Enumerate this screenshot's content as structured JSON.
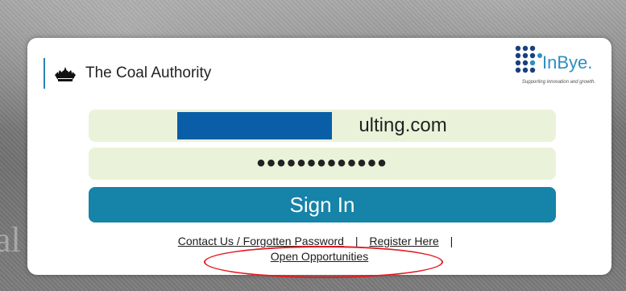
{
  "brand": {
    "name": "The Coal Authority"
  },
  "partner": {
    "name": "InBye.",
    "tagline": "Supporting innovation and growth."
  },
  "login": {
    "email_value": "ne                          ulting.com",
    "password_value": "•••••••••••••",
    "sign_in_label": "Sign In"
  },
  "links": {
    "contact_label": "Contact Us / Forgotten Password",
    "separator": "|",
    "register_label": "Register Here",
    "opportunities_label": "Open Opportunities"
  },
  "colors": {
    "field_bg": "#eaf3d9",
    "button_bg": "#1683a8",
    "redaction": "#0a5ea8",
    "annotation": "#e31b23",
    "brand_accent": "#2d8fbf"
  },
  "icons": {
    "crest": "royal-crest-icon",
    "partner_logo": "inbye-dots-logo-icon"
  }
}
